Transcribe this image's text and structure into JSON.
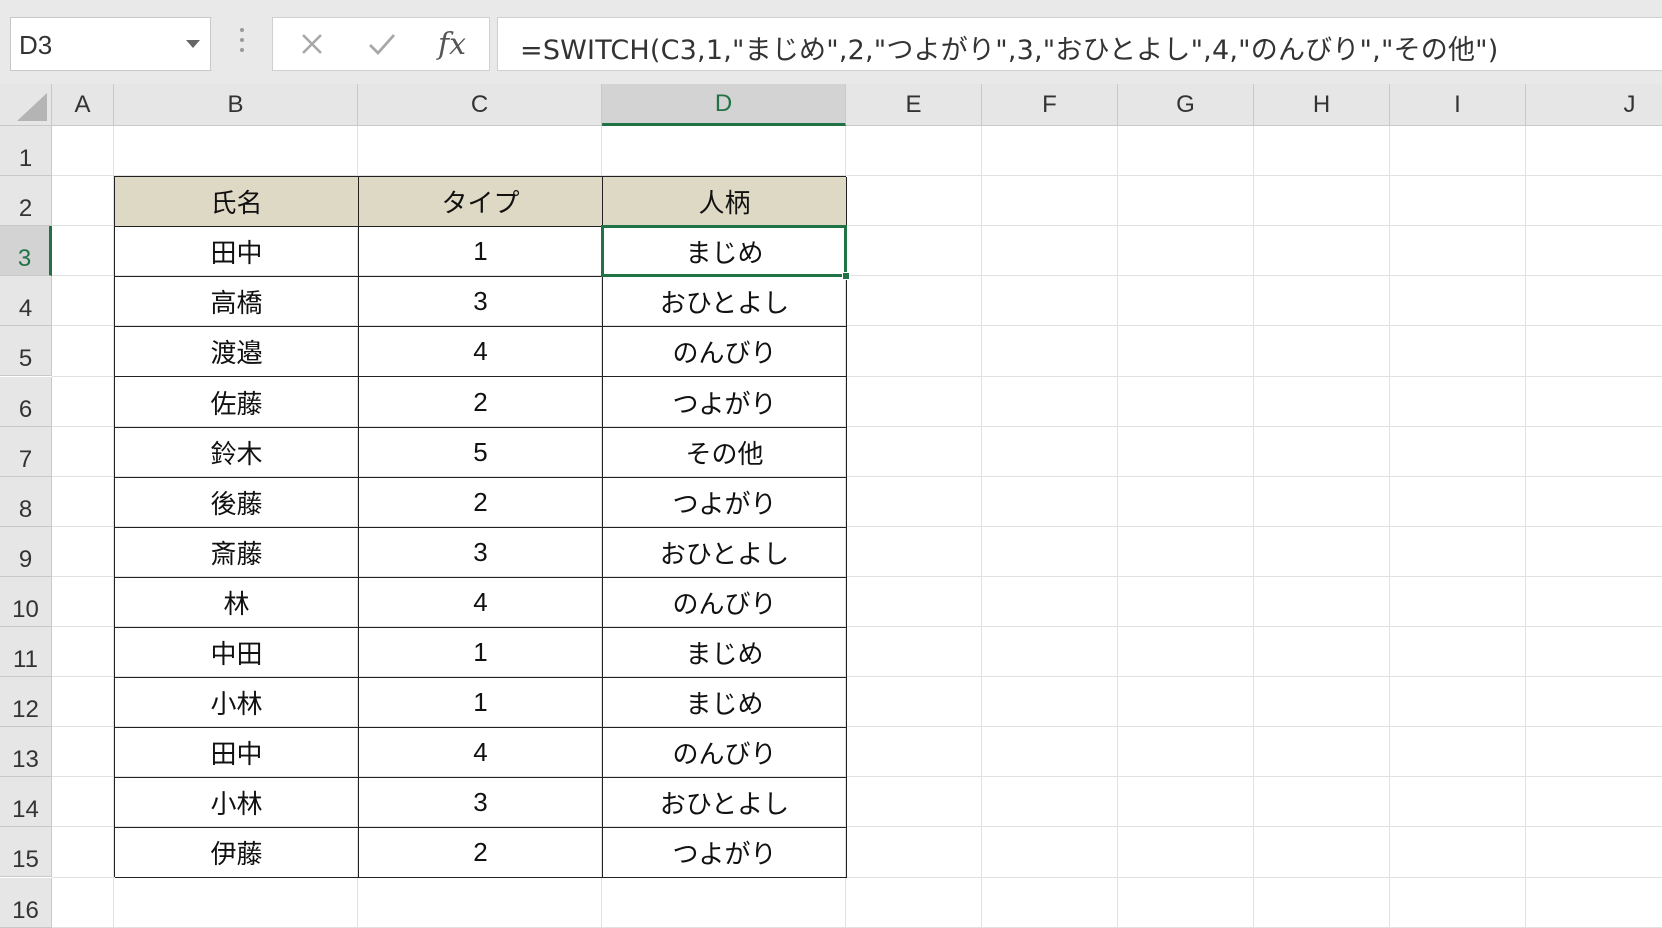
{
  "formula_bar": {
    "name_box": "D3",
    "formula": "=SWITCH(C3,1,\"まじめ\",2,\"つよがり\",3,\"おひとよし\",4,\"のんびり\",\"その他\")",
    "fx_label": "fx"
  },
  "columns": [
    "A",
    "B",
    "C",
    "D",
    "E",
    "F",
    "G",
    "H",
    "I",
    "J"
  ],
  "rows": [
    "1",
    "2",
    "3",
    "4",
    "5",
    "6",
    "7",
    "8",
    "9",
    "10",
    "11",
    "12",
    "13",
    "14",
    "15",
    "16"
  ],
  "active_cell": {
    "column": "D",
    "row": "3"
  },
  "table": {
    "headers": [
      "氏名",
      "タイプ",
      "人柄"
    ],
    "rows": [
      [
        "田中",
        "1",
        "まじめ"
      ],
      [
        "高橋",
        "3",
        "おひとよし"
      ],
      [
        "渡邉",
        "4",
        "のんびり"
      ],
      [
        "佐藤",
        "2",
        "つよがり"
      ],
      [
        "鈴木",
        "5",
        "その他"
      ],
      [
        "後藤",
        "2",
        "つよがり"
      ],
      [
        "斎藤",
        "3",
        "おひとよし"
      ],
      [
        "林",
        "4",
        "のんびり"
      ],
      [
        "中田",
        "1",
        "まじめ"
      ],
      [
        "小林",
        "1",
        "まじめ"
      ],
      [
        "田中",
        "4",
        "のんびり"
      ],
      [
        "小林",
        "3",
        "おひとよし"
      ],
      [
        "伊藤",
        "2",
        "つよがり"
      ]
    ]
  },
  "colors": {
    "accent": "#217346",
    "table_header_bg": "#ddd9c4"
  }
}
